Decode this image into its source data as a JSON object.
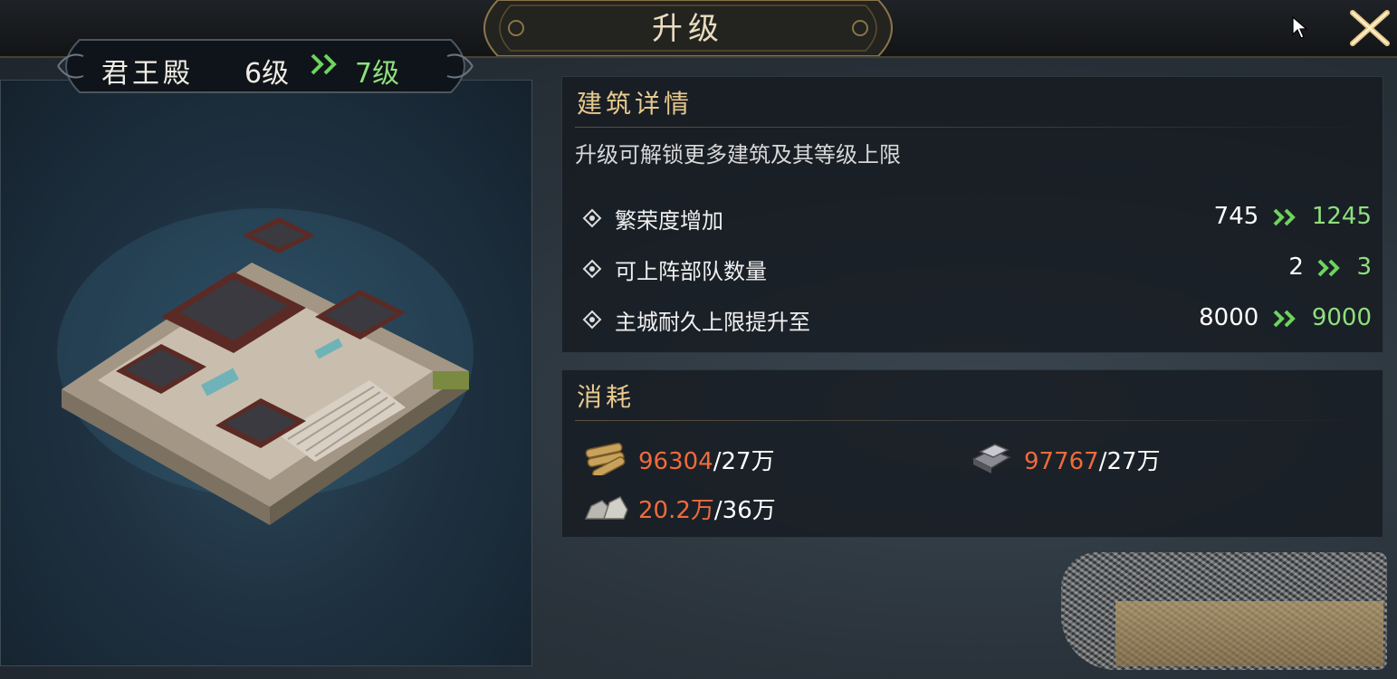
{
  "header": {
    "title": "升级"
  },
  "building": {
    "name": "君王殿",
    "current_level": "6级",
    "next_level": "7级"
  },
  "details": {
    "title": "建筑详情",
    "description": "升级可解锁更多建筑及其等级上限",
    "stats": [
      {
        "label": "繁荣度增加",
        "from": "745",
        "to": "1245"
      },
      {
        "label": "可上阵部队数量",
        "from": "2",
        "to": "3"
      },
      {
        "label": "主城耐久上限提升至",
        "from": "8000",
        "to": "9000"
      }
    ]
  },
  "consume": {
    "title": "消耗",
    "resources": [
      {
        "icon": "wood-icon",
        "current": "96304",
        "required": "/27万"
      },
      {
        "icon": "iron-icon",
        "current": "97767",
        "required": "/27万"
      },
      {
        "icon": "stone-icon",
        "current": "20.2万",
        "required": "/36万"
      }
    ]
  },
  "colors": {
    "accent_gold": "#e6c98d",
    "upgrade_green": "#8fe07c",
    "insufficient_orange": "#f06a3c"
  }
}
